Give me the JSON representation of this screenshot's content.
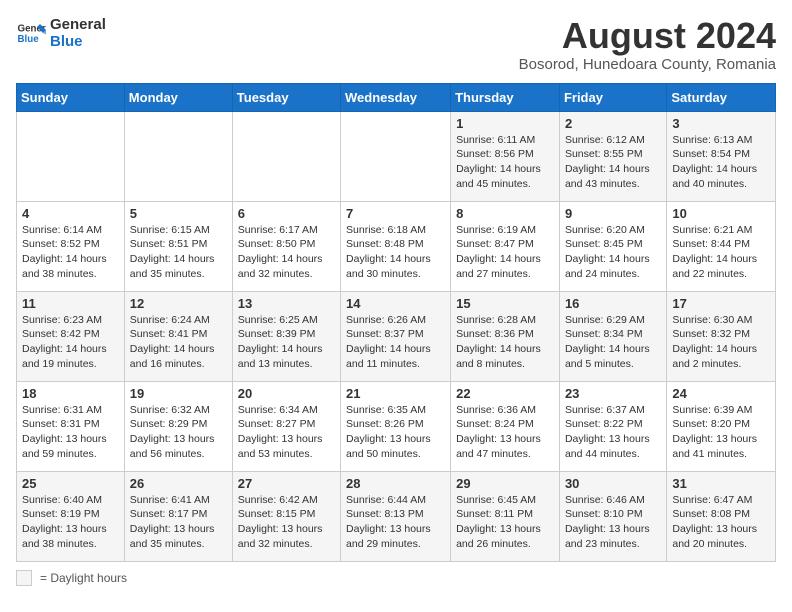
{
  "header": {
    "logo_line1": "General",
    "logo_line2": "Blue",
    "month_year": "August 2024",
    "location": "Bosorod, Hunedoara County, Romania"
  },
  "days_of_week": [
    "Sunday",
    "Monday",
    "Tuesday",
    "Wednesday",
    "Thursday",
    "Friday",
    "Saturday"
  ],
  "weeks": [
    [
      {
        "day": "",
        "info": ""
      },
      {
        "day": "",
        "info": ""
      },
      {
        "day": "",
        "info": ""
      },
      {
        "day": "",
        "info": ""
      },
      {
        "day": "1",
        "info": "Sunrise: 6:11 AM\nSunset: 8:56 PM\nDaylight: 14 hours and 45 minutes."
      },
      {
        "day": "2",
        "info": "Sunrise: 6:12 AM\nSunset: 8:55 PM\nDaylight: 14 hours and 43 minutes."
      },
      {
        "day": "3",
        "info": "Sunrise: 6:13 AM\nSunset: 8:54 PM\nDaylight: 14 hours and 40 minutes."
      }
    ],
    [
      {
        "day": "4",
        "info": "Sunrise: 6:14 AM\nSunset: 8:52 PM\nDaylight: 14 hours and 38 minutes."
      },
      {
        "day": "5",
        "info": "Sunrise: 6:15 AM\nSunset: 8:51 PM\nDaylight: 14 hours and 35 minutes."
      },
      {
        "day": "6",
        "info": "Sunrise: 6:17 AM\nSunset: 8:50 PM\nDaylight: 14 hours and 32 minutes."
      },
      {
        "day": "7",
        "info": "Sunrise: 6:18 AM\nSunset: 8:48 PM\nDaylight: 14 hours and 30 minutes."
      },
      {
        "day": "8",
        "info": "Sunrise: 6:19 AM\nSunset: 8:47 PM\nDaylight: 14 hours and 27 minutes."
      },
      {
        "day": "9",
        "info": "Sunrise: 6:20 AM\nSunset: 8:45 PM\nDaylight: 14 hours and 24 minutes."
      },
      {
        "day": "10",
        "info": "Sunrise: 6:21 AM\nSunset: 8:44 PM\nDaylight: 14 hours and 22 minutes."
      }
    ],
    [
      {
        "day": "11",
        "info": "Sunrise: 6:23 AM\nSunset: 8:42 PM\nDaylight: 14 hours and 19 minutes."
      },
      {
        "day": "12",
        "info": "Sunrise: 6:24 AM\nSunset: 8:41 PM\nDaylight: 14 hours and 16 minutes."
      },
      {
        "day": "13",
        "info": "Sunrise: 6:25 AM\nSunset: 8:39 PM\nDaylight: 14 hours and 13 minutes."
      },
      {
        "day": "14",
        "info": "Sunrise: 6:26 AM\nSunset: 8:37 PM\nDaylight: 14 hours and 11 minutes."
      },
      {
        "day": "15",
        "info": "Sunrise: 6:28 AM\nSunset: 8:36 PM\nDaylight: 14 hours and 8 minutes."
      },
      {
        "day": "16",
        "info": "Sunrise: 6:29 AM\nSunset: 8:34 PM\nDaylight: 14 hours and 5 minutes."
      },
      {
        "day": "17",
        "info": "Sunrise: 6:30 AM\nSunset: 8:32 PM\nDaylight: 14 hours and 2 minutes."
      }
    ],
    [
      {
        "day": "18",
        "info": "Sunrise: 6:31 AM\nSunset: 8:31 PM\nDaylight: 13 hours and 59 minutes."
      },
      {
        "day": "19",
        "info": "Sunrise: 6:32 AM\nSunset: 8:29 PM\nDaylight: 13 hours and 56 minutes."
      },
      {
        "day": "20",
        "info": "Sunrise: 6:34 AM\nSunset: 8:27 PM\nDaylight: 13 hours and 53 minutes."
      },
      {
        "day": "21",
        "info": "Sunrise: 6:35 AM\nSunset: 8:26 PM\nDaylight: 13 hours and 50 minutes."
      },
      {
        "day": "22",
        "info": "Sunrise: 6:36 AM\nSunset: 8:24 PM\nDaylight: 13 hours and 47 minutes."
      },
      {
        "day": "23",
        "info": "Sunrise: 6:37 AM\nSunset: 8:22 PM\nDaylight: 13 hours and 44 minutes."
      },
      {
        "day": "24",
        "info": "Sunrise: 6:39 AM\nSunset: 8:20 PM\nDaylight: 13 hours and 41 minutes."
      }
    ],
    [
      {
        "day": "25",
        "info": "Sunrise: 6:40 AM\nSunset: 8:19 PM\nDaylight: 13 hours and 38 minutes."
      },
      {
        "day": "26",
        "info": "Sunrise: 6:41 AM\nSunset: 8:17 PM\nDaylight: 13 hours and 35 minutes."
      },
      {
        "day": "27",
        "info": "Sunrise: 6:42 AM\nSunset: 8:15 PM\nDaylight: 13 hours and 32 minutes."
      },
      {
        "day": "28",
        "info": "Sunrise: 6:44 AM\nSunset: 8:13 PM\nDaylight: 13 hours and 29 minutes."
      },
      {
        "day": "29",
        "info": "Sunrise: 6:45 AM\nSunset: 8:11 PM\nDaylight: 13 hours and 26 minutes."
      },
      {
        "day": "30",
        "info": "Sunrise: 6:46 AM\nSunset: 8:10 PM\nDaylight: 13 hours and 23 minutes."
      },
      {
        "day": "31",
        "info": "Sunrise: 6:47 AM\nSunset: 8:08 PM\nDaylight: 13 hours and 20 minutes."
      }
    ]
  ],
  "legend": {
    "box_label": "= Daylight hours"
  }
}
